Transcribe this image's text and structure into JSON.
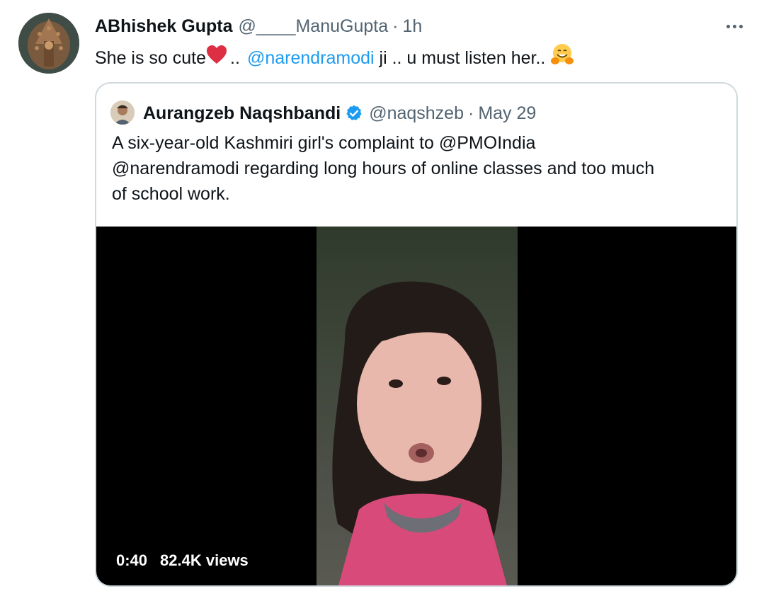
{
  "tweet": {
    "author_name": "ABhishek Gupta",
    "author_handle": "@____ManuGupta",
    "separator": "·",
    "time": "1h",
    "text_before": "She is so cute",
    "text_dots": "..",
    "mention": "@narendramodi",
    "text_after": " ji .. u must listen her.. ",
    "heart_emoji": "red-heart-icon",
    "hug_emoji": "hugging-face-icon"
  },
  "quoted": {
    "author_name": "Aurangzeb Naqshbandi",
    "author_handle": "@naqshzeb",
    "separator": "·",
    "date": "May 29",
    "text_lines": [
      "A six-year-old Kashmiri girl's complaint to @PMOIndia",
      "@narendramodi regarding long hours of online classes and too much",
      "of school work."
    ],
    "verified_icon": "verified-badge-icon"
  },
  "video": {
    "duration": "0:40",
    "views": "82.4K views"
  },
  "colors": {
    "link": "#1d9bf0",
    "secondary_text": "#536471",
    "border": "#cfd9de",
    "media_bg": "#000000"
  }
}
